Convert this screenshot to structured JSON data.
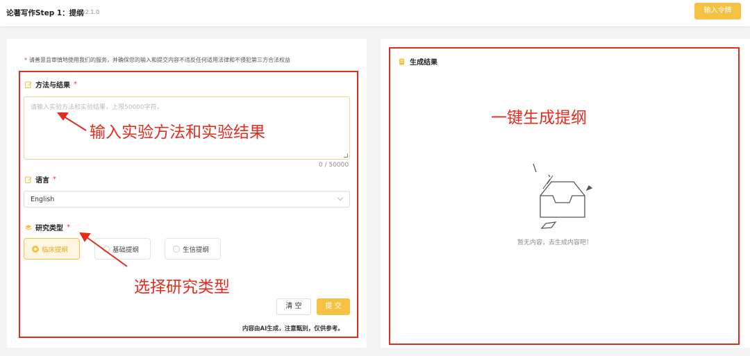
{
  "header": {
    "title": "论著写作Step 1：提纲",
    "version": "v2.1.0",
    "token_button": "输入令牌"
  },
  "form": {
    "notice": "请善意且审慎地使用我们的服务，并确保您的输入和提交内容不违反任何适用法律和不侵犯第三方合法权益",
    "notice_mark": "*",
    "methods_label": "方法与结果",
    "methods_placeholder": "请输入实验方法和实验结果，上限50000字符。",
    "counter": "0 / 50000",
    "language_label": "语言",
    "language_value": "English",
    "study_type_label": "研究类型",
    "required_mark": "*",
    "study_types": [
      {
        "label": "临床提纲",
        "selected": true
      },
      {
        "label": "基础提纲",
        "selected": false
      },
      {
        "label": "生信提纲",
        "selected": false
      }
    ],
    "clear_button": "清 空",
    "submit_button": "提 交",
    "disclaimer": "内容由AI生成，注意甄别，仅供参考。"
  },
  "result": {
    "title": "生成结果",
    "empty_text": "暂无内容，去生成内容吧！"
  },
  "annotations": {
    "input_methods": "输入实验方法和实验结果",
    "choose_type": "选择研究类型",
    "generate": "一键生成提纲"
  },
  "colors": {
    "accent": "#f5c143",
    "annotation": "#e32c1e"
  }
}
